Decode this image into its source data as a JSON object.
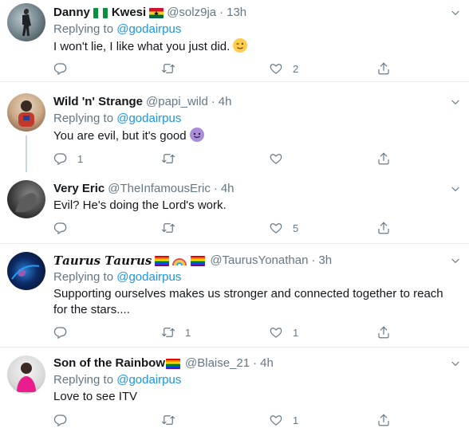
{
  "tweets": [
    {
      "name": "Danny",
      "name_suffix": "Kwesi",
      "handle": "@solz9ja",
      "time": "13h",
      "reply_prefix": "Replying to",
      "reply_to": "@godairpus",
      "text": "I won't lie, I like what you just did.",
      "counts": {
        "reply": "",
        "retweet": "",
        "like": "2"
      }
    },
    {
      "name": "Wild 'n' Strange",
      "handle": "@papi_wild",
      "time": "4h",
      "reply_prefix": "Replying to",
      "reply_to": "@godairpus",
      "text": "You are evil, but it's good",
      "counts": {
        "reply": "1",
        "retweet": "",
        "like": ""
      }
    },
    {
      "name": "Very Eric",
      "handle": "@TheInfamousEric",
      "time": "4h",
      "text": "Evil? He's doing the Lord's work.",
      "counts": {
        "reply": "",
        "retweet": "",
        "like": "5"
      }
    },
    {
      "name": "𝑻𝒂𝒖𝒓𝒖𝒔 𝑻𝒂𝒖𝒓𝒖𝒔",
      "handle": "@TaurusYonathan",
      "time": "3h",
      "reply_prefix": "Replying to",
      "reply_to": "@godairpus",
      "text_line1": "Supporting ourselves makes us stronger and connected together to reach",
      "text_line2": "for the stars....",
      "counts": {
        "reply": "",
        "retweet": "1",
        "like": "1"
      }
    },
    {
      "name": "Son of the Rainbow",
      "handle": "@Blaise_21",
      "time": "4h",
      "reply_prefix": "Replying to",
      "reply_to": "@godairpus",
      "text": "Love to see ITV",
      "counts": {
        "reply": "",
        "retweet": "",
        "like": "1"
      }
    }
  ],
  "ui": {
    "dot": "·",
    "colors": {
      "accent": "#1b95e0",
      "muted": "#657786",
      "text": "#14171a",
      "border": "#e6ecf0"
    }
  }
}
